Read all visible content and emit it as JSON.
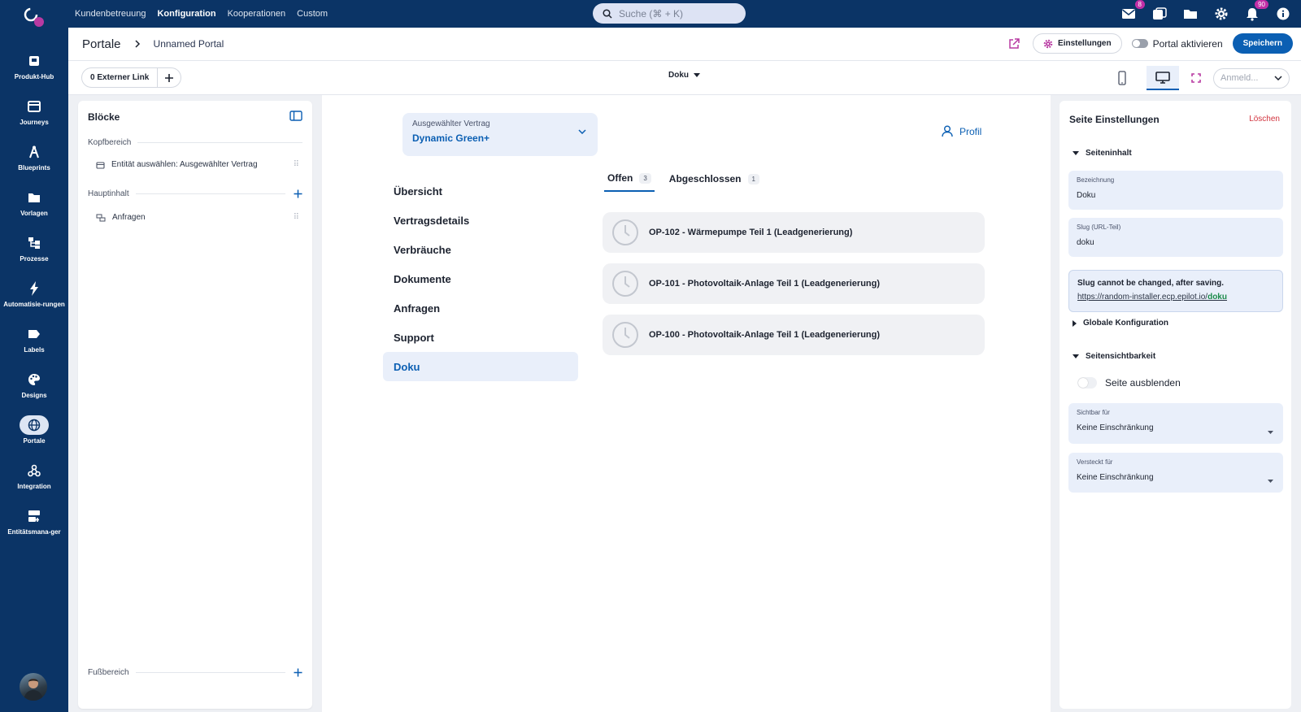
{
  "topbar": {
    "nav": [
      "Kundenbetreuung",
      "Konfiguration",
      "Kooperationen",
      "Custom"
    ],
    "active_nav": "Konfiguration",
    "search_placeholder": "Suche (⌘ + K)",
    "mail_badge": "8",
    "notif_badge": "90"
  },
  "sidebar": {
    "items": [
      {
        "label": "Produkt-Hub",
        "icon": "store-icon"
      },
      {
        "label": "Journeys",
        "icon": "journey-icon"
      },
      {
        "label": "Blueprints",
        "icon": "blueprint-icon"
      },
      {
        "label": "Vorlagen",
        "icon": "folder-icon"
      },
      {
        "label": "Prozesse",
        "icon": "process-icon"
      },
      {
        "label": "Automatisie-rungen",
        "icon": "bolt-icon"
      },
      {
        "label": "Labels",
        "icon": "label-icon"
      },
      {
        "label": "Designs",
        "icon": "palette-icon"
      },
      {
        "label": "Portale",
        "icon": "globe-icon"
      },
      {
        "label": "Integration",
        "icon": "webhook-icon"
      },
      {
        "label": "Entitätsmana-ger",
        "icon": "entity-icon"
      }
    ],
    "active": "Portale"
  },
  "header": {
    "title": "Portale",
    "portal_name": "Unnamed Portal",
    "settings_label": "Einstellungen",
    "activate_label": "Portal aktivieren",
    "save_label": "Speichern"
  },
  "subheader": {
    "ext_link_label": "0 Externer Link",
    "page_select": "Doku",
    "login_placeholder": "Anmeld..."
  },
  "blocks": {
    "title": "Blöcke",
    "head_section": "Kopfbereich",
    "head_item": "Entität auswählen: Ausgewählter Vertrag",
    "main_section": "Hauptinhalt",
    "main_item": "Anfragen",
    "footer_section": "Fußbereich"
  },
  "preview": {
    "contract_label": "Ausgewählter Vertrag",
    "contract_value": "Dynamic Green+",
    "profile_label": "Profil",
    "nav": [
      "Übersicht",
      "Vertragsdetails",
      "Verbräuche",
      "Dokumente",
      "Anfragen",
      "Support",
      "Doku"
    ],
    "active_nav": "Doku",
    "tabs": [
      {
        "label": "Offen",
        "count": "3"
      },
      {
        "label": "Abgeschlossen",
        "count": "1"
      }
    ],
    "requests": [
      "OP-102 - Wärmepumpe Teil 1 (Leadgenerierung)",
      "OP-101 - Photovoltaik-Anlage Teil 1 (Leadgenerierung)",
      "OP-100 - Photovoltaik-Anlage Teil 1 (Leadgenerierung)"
    ]
  },
  "settings": {
    "title": "Seite Einstellungen",
    "delete_label": "Löschen",
    "content_section": "Seiteninhalt",
    "name_label": "Bezeichnung",
    "name_value": "Doku",
    "slug_label": "Slug (URL-Teil)",
    "slug_value": "doku",
    "slug_note": "Slug cannot be changed, after saving.",
    "slug_url_base": "https://random-installer.ecp.epilot.io/",
    "slug_url_slug": "doku",
    "global_section": "Globale Konfiguration",
    "visibility_section": "Seitensichtbarkeit",
    "hide_label": "Seite ausblenden",
    "visible_for_label": "Sichtbar für",
    "visible_for_value": "Keine Einschränkung",
    "hidden_for_label": "Versteckt für",
    "hidden_for_value": "Keine Einschränkung"
  },
  "colors": {
    "brand": "#0b3466",
    "accent": "#0b5fb3",
    "danger": "#d2343f",
    "badge": "#c02ea6"
  }
}
